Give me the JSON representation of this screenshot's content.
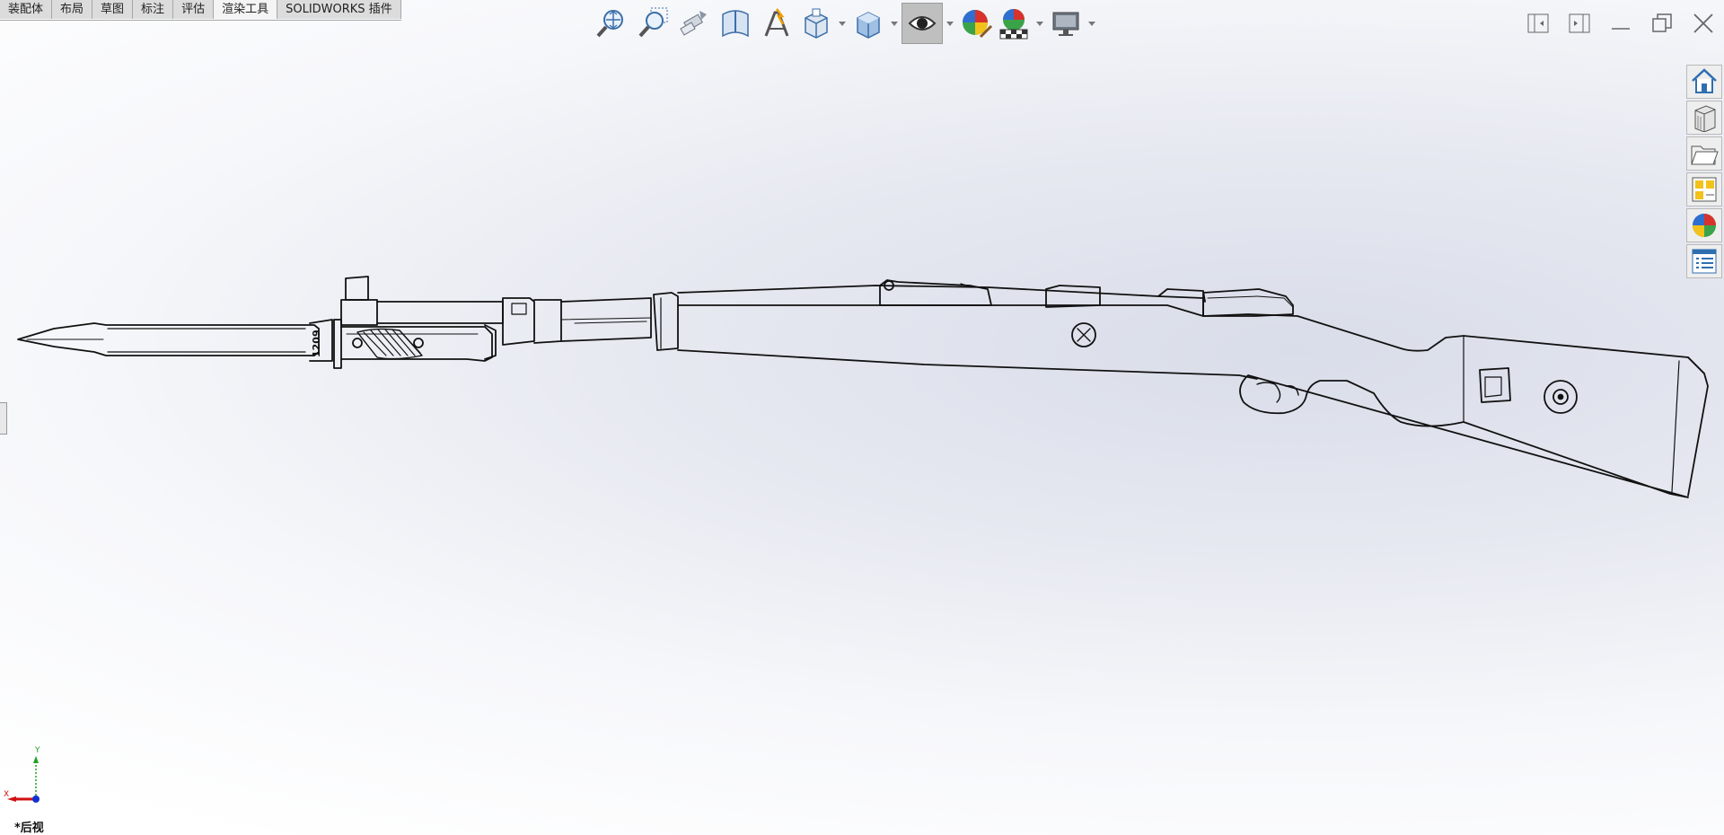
{
  "command_tabs": [
    {
      "label": "装配体",
      "active": false
    },
    {
      "label": "布局",
      "active": false
    },
    {
      "label": "草图",
      "active": false
    },
    {
      "label": "标注",
      "active": false
    },
    {
      "label": "评估",
      "active": false
    },
    {
      "label": "渲染工具",
      "active": true
    },
    {
      "label": "SOLIDWORKS 插件",
      "active": false
    }
  ],
  "hud_icons": [
    "zoom-to-fit-icon",
    "zoom-to-area-icon",
    "previous-view-icon",
    "section-view-icon",
    "dynamic-annotation-icon",
    "view-orientation-icon",
    "display-style-icon",
    "hide-show-items-icon",
    "edit-appearance-icon",
    "apply-scene-icon",
    "view-settings-icon"
  ],
  "model": {
    "bayonet_marking": "1209"
  },
  "triad": {
    "x_label": "X",
    "y_label": "Y"
  },
  "view_label": "*后视",
  "colors": {
    "tab_bg": "#dcdcdc",
    "tab_active_bg": "#f4f4f4",
    "viewport_center": "#d9dde9",
    "triad_x": "#d01010",
    "triad_y": "#20a020",
    "triad_z": "#1030d0"
  }
}
